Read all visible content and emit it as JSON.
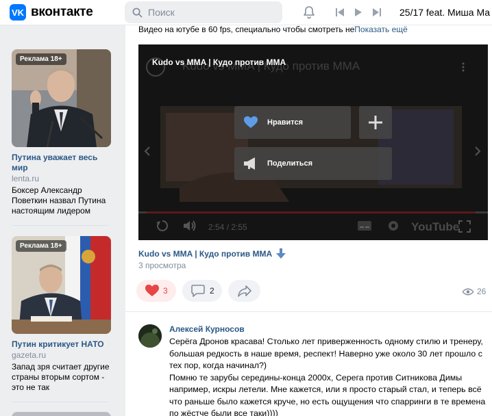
{
  "header": {
    "logo_mark": "VK",
    "logo_text": "вконтакте",
    "search_placeholder": "Поиск",
    "now_playing": "25/17 feat. Миша Ма"
  },
  "ads": [
    {
      "badge": "Реклама 18+",
      "title": "Путина уважает весь мир",
      "domain": "lenta.ru",
      "text": "Боксер Александр Поветкин назвал Путина настоящим лидером"
    },
    {
      "badge": "Реклама 18+",
      "title": "Путин критикует НАТО",
      "domain": "gazeta.ru",
      "text": "Запад зря считает другие страны вторым сортом - это не так"
    }
  ],
  "post": {
    "snippet": "Видео на ютубе в 60 fps, специально чтобы смотреть не",
    "show_more": "Показать ещё",
    "video": {
      "title": "Kudo vs MMA | Кудо против MMA",
      "like_label": "Нравится",
      "share_label": "Поделиться",
      "time": "2:54 / 2:55",
      "youtube": "YouTube"
    },
    "video_name": "Kudo vs MMA | Кудо против MMA",
    "views_text": "3 просмотра",
    "likes": "3",
    "comments": "2",
    "view_count": "26"
  },
  "comment": {
    "author": "Алексей Курносов",
    "p1": "Серёга Дронов красава! Столько лет приверженность одному стилю и тренеру, большая редкость в наше время, респект! Наверно уже около 30 лет прошло с тех пор, когда начинал?)",
    "p2": "Помню те зарубы середины-конца 2000х, Серега против Ситникова Димы например, искры летели. Мне кажется, или я просто старый стал, и теперь всё что раньше было кажется круче, но есть ощущения что спарринги в те времена по жёстче были все таки))))"
  },
  "colors": {
    "brand": "#0077ff",
    "link": "#2a5885",
    "like": "#e64646",
    "muted": "#818c99"
  }
}
